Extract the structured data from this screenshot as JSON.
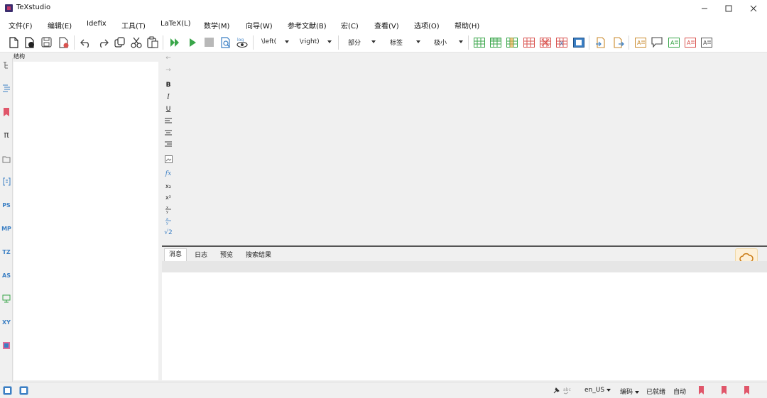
{
  "window": {
    "title": "TeXstudio"
  },
  "menu": [
    "文件(F)",
    "编辑(E)",
    "Idefix",
    "工具(T)",
    "LaTeX(L)",
    "数学(M)",
    "向导(W)",
    "参考文献(B)",
    "宏(C)",
    "查看(V)",
    "选项(O)",
    "帮助(H)"
  ],
  "toolbar": {
    "left_combo": "\\left(",
    "right_combo": "\\right)",
    "section_combo": "部分",
    "label_combo": "标签",
    "size_combo": "极小"
  },
  "structure": {
    "label": "结构"
  },
  "sidebar_labels": {
    "ps": "PS",
    "mp": "MP",
    "tz": "TZ",
    "as": "AS",
    "xy": "XY"
  },
  "symbols": {
    "bold": "B",
    "italic": "I",
    "underline": "U",
    "fx": "fx",
    "sub": "x₂",
    "sup": "x²",
    "sqrt": "√2"
  },
  "bottom_tabs": [
    "消息",
    "日志",
    "预览",
    "搜索结果"
  ],
  "status": {
    "language": "en_US",
    "encoding": "编码",
    "ready": "已就绪",
    "auto": "自动"
  },
  "colors": {
    "accent_blue": "#3b7fc4",
    "green": "#3aa64a",
    "red": "#d9534f",
    "bookmark": "#e0566a"
  }
}
